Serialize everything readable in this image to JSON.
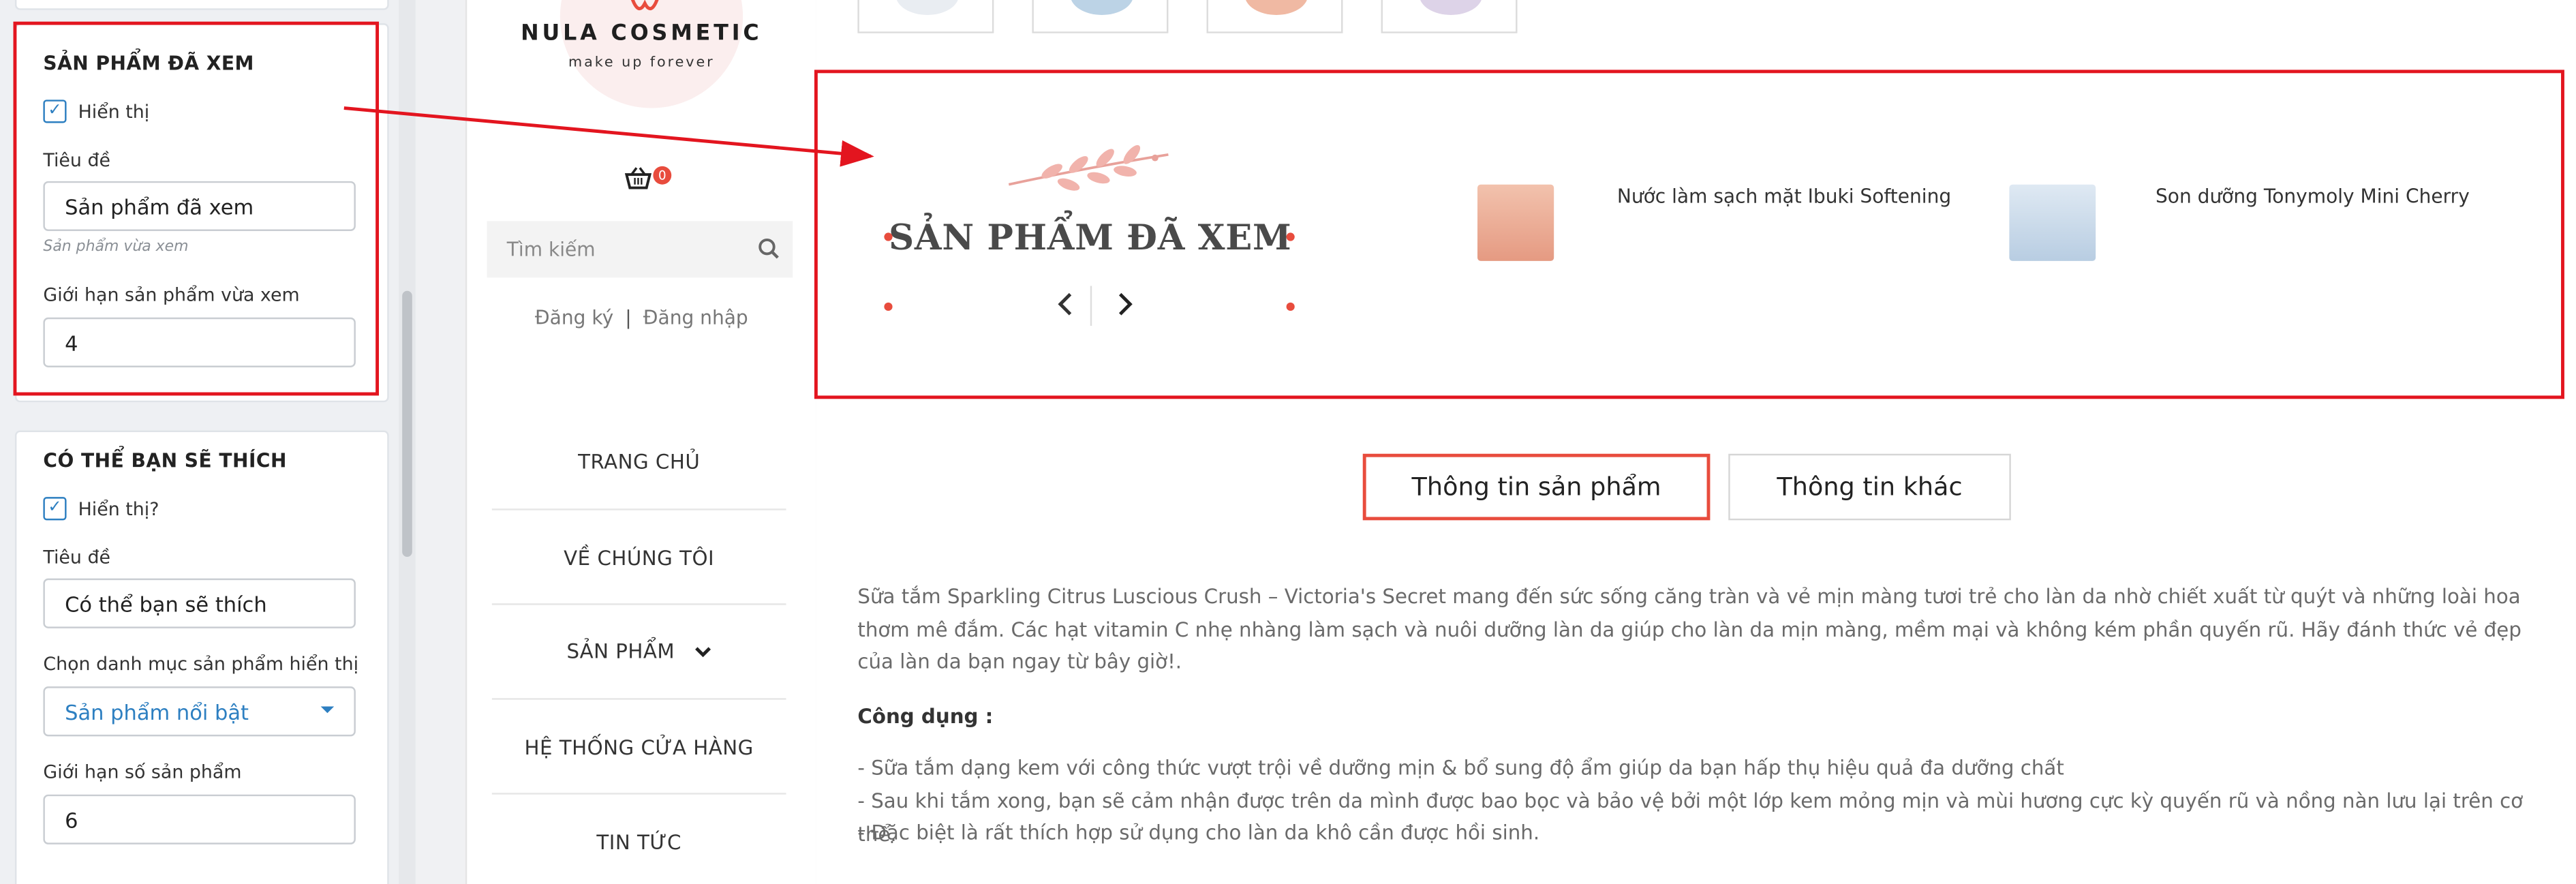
{
  "settings": {
    "card1": {
      "title": "SẢN PHẨM ĐÃ XEM",
      "show_label": "Hiển thị",
      "title_label": "Tiêu đề",
      "title_value": "Sản phẩm đã xem",
      "title_hint": "Sản phẩm vừa xem",
      "limit_label": "Giới hạn sản phẩm vừa xem",
      "limit_value": "4"
    },
    "card2": {
      "title": "CÓ THỂ BẠN SẼ THÍCH",
      "show_label": "Hiển thị?",
      "title_label": "Tiêu đề",
      "title_value": "Có thể bạn sẽ thích",
      "category_label": "Chọn danh mục sản phẩm hiển thị",
      "category_value": "Sản phẩm nổi bật",
      "limit_label": "Giới hạn số sản phẩm",
      "limit_value": "6"
    }
  },
  "site": {
    "logo_name": "NULA COSMETIC",
    "logo_tagline": "make up forever",
    "cart_count": "0",
    "search_placeholder": "Tìm kiếm",
    "register": "Đăng ký",
    "separator": "|",
    "login": "Đăng nhập",
    "nav": [
      "TRANG CHỦ",
      "VỀ CHÚNG TÔI",
      "SẢN PHẨM",
      "HỆ THỐNG CỬA HÀNG",
      "TIN TỨC"
    ]
  },
  "viewed": {
    "title": "SẢN PHẨM ĐÃ XEM",
    "products": [
      {
        "name": "Nước làm sạch mặt Ibuki Softening"
      },
      {
        "name": "Son dưỡng Tonymoly Mini Cherry"
      }
    ]
  },
  "tabs": {
    "info": "Thông tin sản phẩm",
    "other": "Thông tin khác"
  },
  "description": {
    "intro": "Sữa tắm Sparkling Citrus Luscious Crush – Victoria's Secret mang đến sức sống căng tràn và vẻ mịn màng tươi trẻ cho làn da nhờ chiết xuất từ quýt và những loài hoa thơm mê đắm.  Các hạt vitamin C nhẹ nhàng làm sạch và nuôi dưỡng làn da giúp cho làn da mịn màng, mềm mại và không kém phần quyến rũ. Hãy đánh thức vẻ đẹp của làn da bạn ngay từ bây giờ!.",
    "uses_heading": "Công dụng :",
    "bullets": [
      "- Sữa tắm dạng kem với công thức vượt trội về dưỡng mịn & bổ sung độ ẩm giúp da bạn hấp thụ hiệu quả đa dưỡng chất",
      "- Sau khi tắm xong, bạn sẽ cảm nhận được trên da mình được bao bọc và bảo vệ bởi một lớp kem mỏng mịn và mùi hương cực kỳ quyến rũ và nồng nàn lưu lại trên cơ thể.",
      "- Đặc biệt là rất thích hợp sử dụng cho làn da khô cần được hồi sinh."
    ]
  },
  "colors": {
    "accent": "#e84c3d",
    "annotation": "#e3151f",
    "link": "#2d7fc1"
  }
}
